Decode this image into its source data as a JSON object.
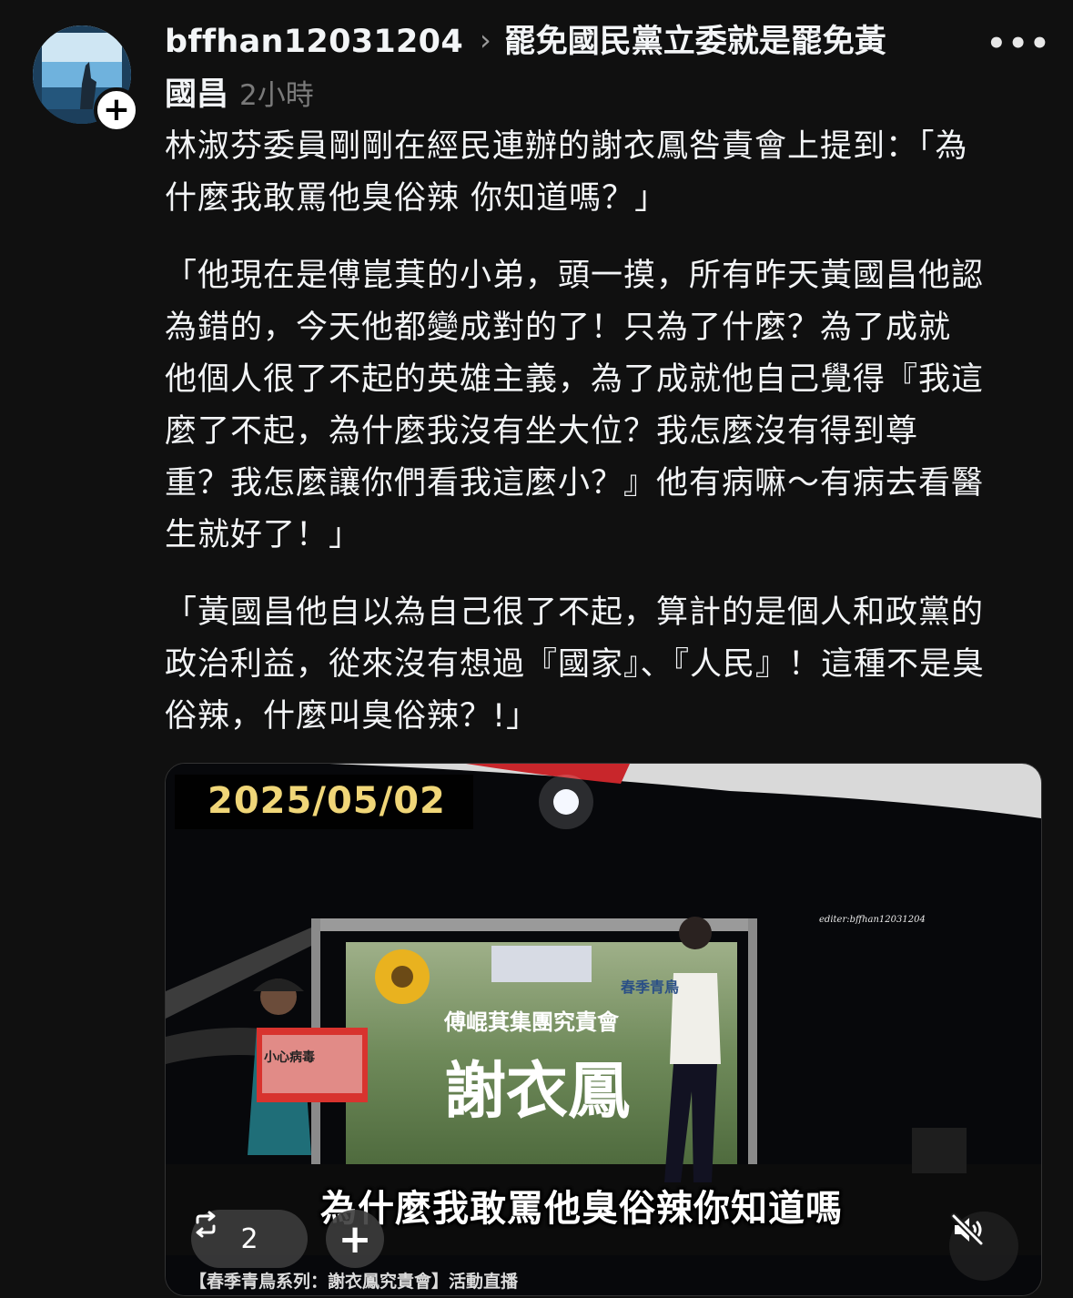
{
  "post": {
    "username": "bffhan12031204",
    "topic_line1": "罷免國民黨立委就是罷免黃",
    "topic_line2": "國昌",
    "time": "2小時",
    "paragraphs": [
      [
        "林淑芬委員剛剛在經民連辦的謝衣鳳咎責會上提到：「為",
        "什麼我敢罵他臭俗辣 你知道嗎？」"
      ],
      [
        "「他現在是傅崑萁的小弟，頭一摸，所有昨天黃國昌他認",
        "為錯的，今天他都變成對的了！只為了什麼？為了成就",
        "他個人很了不起的英雄主義，為了成就他自己覺得『我這",
        "麼了不起，為什麼我沒有坐大位？我怎麼沒有得到尊",
        "重？我怎麼讓你們看我這麼小？』他有病嘛～有病去看醫",
        "生就好了！」"
      ],
      [
        "「黃國昌他自以為自己很了不起，算計的是個人和政黨的",
        "政治利益，從來沒有想過『國家』、『人民』！這種不是臭",
        "俗辣，什麼叫臭俗辣？!」"
      ]
    ]
  },
  "video": {
    "date_overlay": "2025/05/02",
    "editor_watermark": "editer:bffhan12031204",
    "banner_small": "春季青鳥",
    "banner_mid": "傅崐萁集團究責會",
    "banner_big": "謝衣鳳",
    "sign_text": "小心病毒",
    "subtitle": "為什麼我敢罵他臭俗辣你知道嗎",
    "bottom_caption": "【春季青鳥系列：謝衣鳳究責會】活動直播",
    "repost_count": "2"
  },
  "icons": {
    "more": "more-icon",
    "chevron": "chevron-right-icon",
    "follow": "plus-icon",
    "repost": "repost-icon",
    "add": "plus-icon",
    "mute": "speaker-muted-icon"
  }
}
